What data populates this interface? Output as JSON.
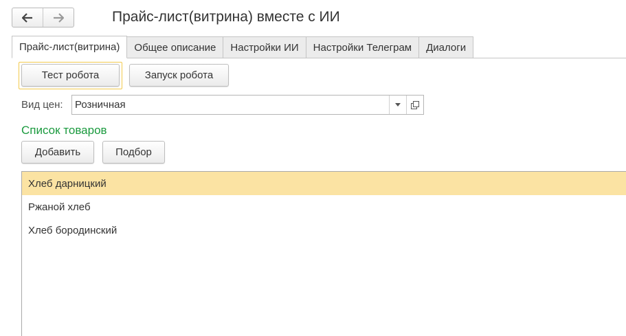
{
  "toolbar": {
    "back_icon": "arrow-left-icon",
    "forward_icon": "arrow-right-icon"
  },
  "window": {
    "title": "Прайс-лист(витрина) вместе с ИИ"
  },
  "tabs": [
    {
      "label": "Прайс-лист(витрина)",
      "active": true
    },
    {
      "label": "Общее описание",
      "active": false
    },
    {
      "label": "Настройки ИИ",
      "active": false
    },
    {
      "label": "Настройки Телеграм",
      "active": false
    },
    {
      "label": "Диалоги",
      "active": false
    }
  ],
  "actions": {
    "test_robot": "Тест робота",
    "run_robot": "Запуск робота"
  },
  "price_type": {
    "label": "Вид цен:",
    "value": "Розничная"
  },
  "products": {
    "title": "Список товаров",
    "add_label": "Добавить",
    "pick_label": "Подбор",
    "items": [
      "Хлеб дарницкий",
      "Ржаной хлеб",
      "Хлеб бородинский"
    ],
    "selected_index": 0
  },
  "colors": {
    "section_title": "#1a9a3e",
    "selection": "#fbe3a3",
    "focus_ring": "#f2c94c"
  }
}
